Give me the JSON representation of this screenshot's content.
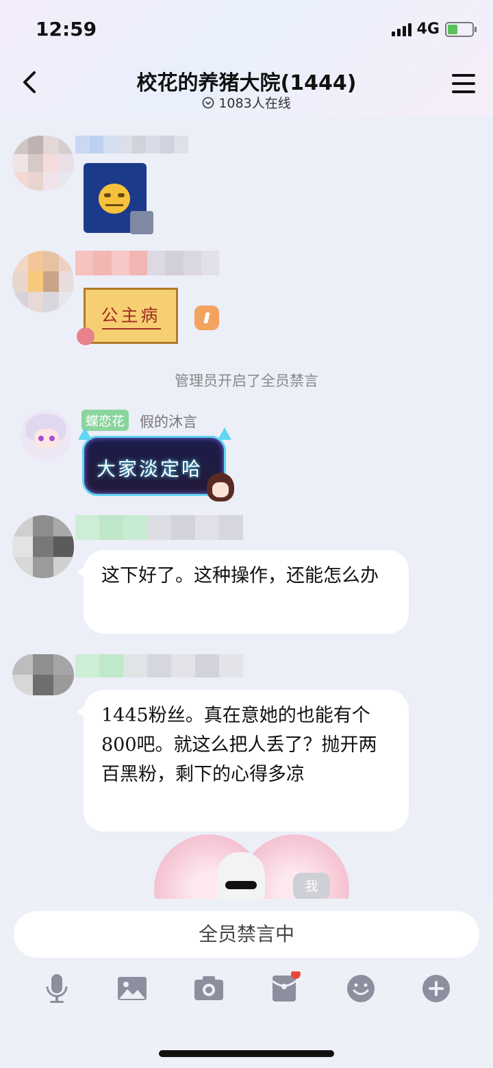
{
  "status_bar": {
    "time": "12:59",
    "network": "4G"
  },
  "header": {
    "title": "校花的养猪大院(1444)",
    "online": "1083人在线"
  },
  "messages": {
    "sticker_label": "公主病",
    "system": "管理员开启了全员禁言",
    "third": {
      "tag": "蝶恋花",
      "nickname": "假的沐言",
      "sticker_text": "大家淡定哈"
    },
    "fourth": {
      "text": "这下好了。这种操作，还能怎么办"
    },
    "fifth": {
      "text": "1445粉丝。真在意她的也能有个800吧。就这么把人丢了？抛开两百黑粉，剩下的心得多凉"
    },
    "self_badge": "我"
  },
  "input": {
    "muted_text": "全员禁言中"
  },
  "icons": [
    "mic-icon",
    "image-icon",
    "camera-icon",
    "red-packet-icon",
    "emoji-icon",
    "plus-icon"
  ],
  "colors": {
    "accent_tag": "#8ad59e",
    "badge_orange": "#f2a35e",
    "notif_red": "#e8483a"
  }
}
